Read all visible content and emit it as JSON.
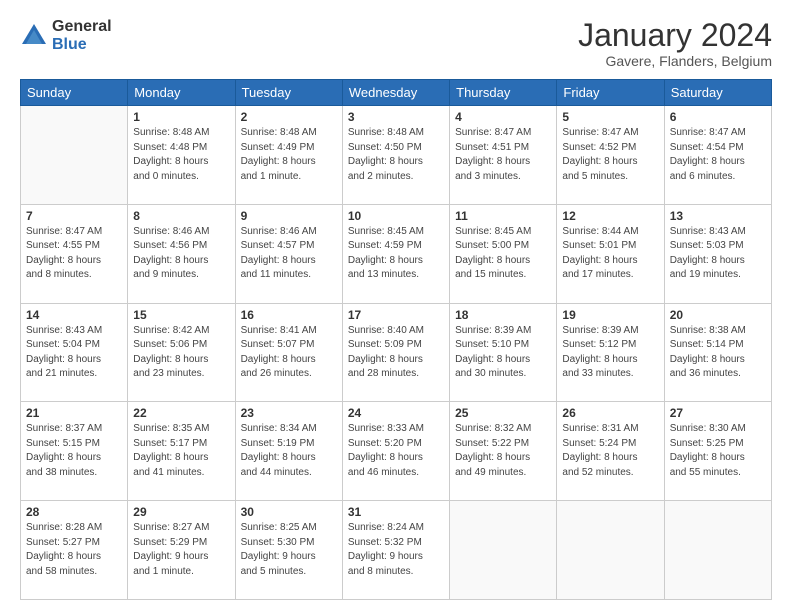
{
  "logo": {
    "general": "General",
    "blue": "Blue"
  },
  "header": {
    "title": "January 2024",
    "subtitle": "Gavere, Flanders, Belgium"
  },
  "days": [
    "Sunday",
    "Monday",
    "Tuesday",
    "Wednesday",
    "Thursday",
    "Friday",
    "Saturday"
  ],
  "weeks": [
    [
      {
        "day": "",
        "content": ""
      },
      {
        "day": "1",
        "content": "Sunrise: 8:48 AM\nSunset: 4:48 PM\nDaylight: 8 hours\nand 0 minutes."
      },
      {
        "day": "2",
        "content": "Sunrise: 8:48 AM\nSunset: 4:49 PM\nDaylight: 8 hours\nand 1 minute."
      },
      {
        "day": "3",
        "content": "Sunrise: 8:48 AM\nSunset: 4:50 PM\nDaylight: 8 hours\nand 2 minutes."
      },
      {
        "day": "4",
        "content": "Sunrise: 8:47 AM\nSunset: 4:51 PM\nDaylight: 8 hours\nand 3 minutes."
      },
      {
        "day": "5",
        "content": "Sunrise: 8:47 AM\nSunset: 4:52 PM\nDaylight: 8 hours\nand 5 minutes."
      },
      {
        "day": "6",
        "content": "Sunrise: 8:47 AM\nSunset: 4:54 PM\nDaylight: 8 hours\nand 6 minutes."
      }
    ],
    [
      {
        "day": "7",
        "content": "Sunrise: 8:47 AM\nSunset: 4:55 PM\nDaylight: 8 hours\nand 8 minutes."
      },
      {
        "day": "8",
        "content": "Sunrise: 8:46 AM\nSunset: 4:56 PM\nDaylight: 8 hours\nand 9 minutes."
      },
      {
        "day": "9",
        "content": "Sunrise: 8:46 AM\nSunset: 4:57 PM\nDaylight: 8 hours\nand 11 minutes."
      },
      {
        "day": "10",
        "content": "Sunrise: 8:45 AM\nSunset: 4:59 PM\nDaylight: 8 hours\nand 13 minutes."
      },
      {
        "day": "11",
        "content": "Sunrise: 8:45 AM\nSunset: 5:00 PM\nDaylight: 8 hours\nand 15 minutes."
      },
      {
        "day": "12",
        "content": "Sunrise: 8:44 AM\nSunset: 5:01 PM\nDaylight: 8 hours\nand 17 minutes."
      },
      {
        "day": "13",
        "content": "Sunrise: 8:43 AM\nSunset: 5:03 PM\nDaylight: 8 hours\nand 19 minutes."
      }
    ],
    [
      {
        "day": "14",
        "content": "Sunrise: 8:43 AM\nSunset: 5:04 PM\nDaylight: 8 hours\nand 21 minutes."
      },
      {
        "day": "15",
        "content": "Sunrise: 8:42 AM\nSunset: 5:06 PM\nDaylight: 8 hours\nand 23 minutes."
      },
      {
        "day": "16",
        "content": "Sunrise: 8:41 AM\nSunset: 5:07 PM\nDaylight: 8 hours\nand 26 minutes."
      },
      {
        "day": "17",
        "content": "Sunrise: 8:40 AM\nSunset: 5:09 PM\nDaylight: 8 hours\nand 28 minutes."
      },
      {
        "day": "18",
        "content": "Sunrise: 8:39 AM\nSunset: 5:10 PM\nDaylight: 8 hours\nand 30 minutes."
      },
      {
        "day": "19",
        "content": "Sunrise: 8:39 AM\nSunset: 5:12 PM\nDaylight: 8 hours\nand 33 minutes."
      },
      {
        "day": "20",
        "content": "Sunrise: 8:38 AM\nSunset: 5:14 PM\nDaylight: 8 hours\nand 36 minutes."
      }
    ],
    [
      {
        "day": "21",
        "content": "Sunrise: 8:37 AM\nSunset: 5:15 PM\nDaylight: 8 hours\nand 38 minutes."
      },
      {
        "day": "22",
        "content": "Sunrise: 8:35 AM\nSunset: 5:17 PM\nDaylight: 8 hours\nand 41 minutes."
      },
      {
        "day": "23",
        "content": "Sunrise: 8:34 AM\nSunset: 5:19 PM\nDaylight: 8 hours\nand 44 minutes."
      },
      {
        "day": "24",
        "content": "Sunrise: 8:33 AM\nSunset: 5:20 PM\nDaylight: 8 hours\nand 46 minutes."
      },
      {
        "day": "25",
        "content": "Sunrise: 8:32 AM\nSunset: 5:22 PM\nDaylight: 8 hours\nand 49 minutes."
      },
      {
        "day": "26",
        "content": "Sunrise: 8:31 AM\nSunset: 5:24 PM\nDaylight: 8 hours\nand 52 minutes."
      },
      {
        "day": "27",
        "content": "Sunrise: 8:30 AM\nSunset: 5:25 PM\nDaylight: 8 hours\nand 55 minutes."
      }
    ],
    [
      {
        "day": "28",
        "content": "Sunrise: 8:28 AM\nSunset: 5:27 PM\nDaylight: 8 hours\nand 58 minutes."
      },
      {
        "day": "29",
        "content": "Sunrise: 8:27 AM\nSunset: 5:29 PM\nDaylight: 9 hours\nand 1 minute."
      },
      {
        "day": "30",
        "content": "Sunrise: 8:25 AM\nSunset: 5:30 PM\nDaylight: 9 hours\nand 5 minutes."
      },
      {
        "day": "31",
        "content": "Sunrise: 8:24 AM\nSunset: 5:32 PM\nDaylight: 9 hours\nand 8 minutes."
      },
      {
        "day": "",
        "content": ""
      },
      {
        "day": "",
        "content": ""
      },
      {
        "day": "",
        "content": ""
      }
    ]
  ]
}
